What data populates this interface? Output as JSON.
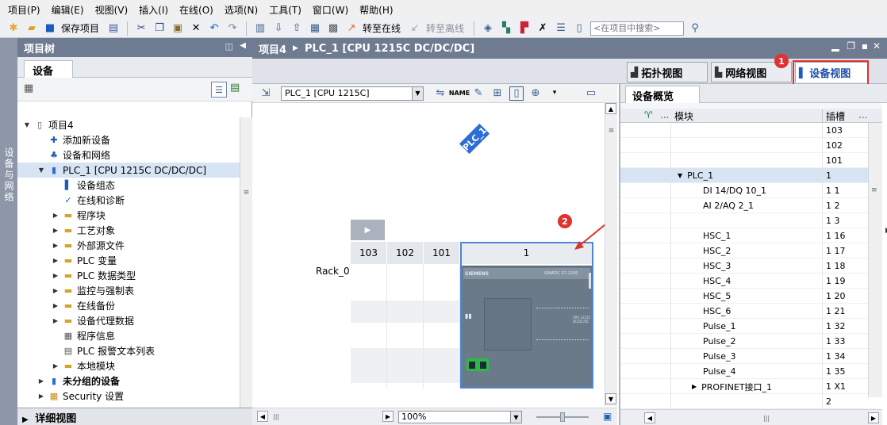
{
  "menu": [
    "项目(P)",
    "编辑(E)",
    "视图(V)",
    "插入(I)",
    "在线(O)",
    "选项(N)",
    "工具(T)",
    "窗口(W)",
    "帮助(H)"
  ],
  "toolbar": {
    "save_project": "保存项目",
    "go_online": "转至在线",
    "go_offline": "转至离线",
    "search_placeholder": "<在项目中搜索>"
  },
  "side_tab": "设备与网络",
  "project_tree": {
    "title": "项目树",
    "tab": "设备",
    "items": [
      {
        "label": "项目4",
        "level": 0,
        "expand": "open",
        "icon": "project-icon"
      },
      {
        "label": "添加新设备",
        "level": 1,
        "expand": "",
        "icon": "add-device-icon"
      },
      {
        "label": "设备和网络",
        "level": 1,
        "expand": "",
        "icon": "network-icon"
      },
      {
        "label": "PLC_1 [CPU 1215C DC/DC/DC]",
        "level": 1,
        "expand": "open",
        "icon": "plc-icon",
        "selected": true
      },
      {
        "label": "设备组态",
        "level": 2,
        "expand": "",
        "icon": "device-config-icon"
      },
      {
        "label": "在线和诊断",
        "level": 2,
        "expand": "",
        "icon": "diagnostics-icon"
      },
      {
        "label": "程序块",
        "level": 2,
        "expand": "closed",
        "icon": "folder-icon"
      },
      {
        "label": "工艺对象",
        "level": 2,
        "expand": "closed",
        "icon": "folder-icon"
      },
      {
        "label": "外部源文件",
        "level": 2,
        "expand": "closed",
        "icon": "folder-icon"
      },
      {
        "label": "PLC 变量",
        "level": 2,
        "expand": "closed",
        "icon": "folder-icon"
      },
      {
        "label": "PLC 数据类型",
        "level": 2,
        "expand": "closed",
        "icon": "folder-icon"
      },
      {
        "label": "监控与强制表",
        "level": 2,
        "expand": "closed",
        "icon": "folder-icon"
      },
      {
        "label": "在线备份",
        "level": 2,
        "expand": "closed",
        "icon": "folder-icon"
      },
      {
        "label": "设备代理数据",
        "level": 2,
        "expand": "closed",
        "icon": "folder-icon"
      },
      {
        "label": "程序信息",
        "level": 2,
        "expand": "",
        "icon": "program-info-icon"
      },
      {
        "label": "PLC 报警文本列表",
        "level": 2,
        "expand": "",
        "icon": "alarm-text-icon"
      },
      {
        "label": "本地模块",
        "level": 2,
        "expand": "closed",
        "icon": "folder-icon"
      },
      {
        "label": "未分组的设备",
        "level": 1,
        "expand": "closed",
        "icon": "ungrouped-icon",
        "bold": true
      },
      {
        "label": "Security 设置",
        "level": 1,
        "expand": "closed",
        "icon": "security-icon"
      }
    ],
    "detail_view": "详细视图"
  },
  "editor": {
    "breadcrumb_project": "项目4",
    "breadcrumb_device": "PLC_1 [CPU 1215C DC/DC/DC]",
    "view_tabs": [
      {
        "label": "拓扑视图",
        "icon": "topology-icon"
      },
      {
        "label": "网络视图",
        "icon": "network-view-icon"
      },
      {
        "label": "设备视图",
        "icon": "device-view-icon",
        "active": true
      }
    ],
    "device_select": "PLC_1 [CPU 1215C]",
    "plc_tag": "PLC_1",
    "rack_label": "Rack_0",
    "slots": [
      "103",
      "102",
      "101",
      "1"
    ],
    "cpu_brand": "SIEMENS",
    "cpu_model": "SIMATIC S7-1200",
    "cpu_type": "CPU 1215C DC/DC/DC",
    "zoom": "100%",
    "badges": [
      "1",
      "2"
    ]
  },
  "overview": {
    "tab": "设备概览",
    "col_module": "模块",
    "col_slot": "插槽",
    "col_more": "...",
    "rows": [
      {
        "module": "",
        "slot": "103",
        "level": 0,
        "expand": ""
      },
      {
        "module": "",
        "slot": "102",
        "level": 0,
        "expand": ""
      },
      {
        "module": "",
        "slot": "101",
        "level": 0,
        "expand": ""
      },
      {
        "module": "PLC_1",
        "slot": "1",
        "level": 1,
        "expand": "open",
        "selected": true
      },
      {
        "module": "DI 14/DQ 10_1",
        "slot": "1 1",
        "level": 2,
        "expand": ""
      },
      {
        "module": "AI 2/AQ 2_1",
        "slot": "1 2",
        "level": 2,
        "expand": ""
      },
      {
        "module": "",
        "slot": "1 3",
        "level": 2,
        "expand": ""
      },
      {
        "module": "HSC_1",
        "slot": "1 16",
        "level": 2,
        "expand": ""
      },
      {
        "module": "HSC_2",
        "slot": "1 17",
        "level": 2,
        "expand": ""
      },
      {
        "module": "HSC_3",
        "slot": "1 18",
        "level": 2,
        "expand": ""
      },
      {
        "module": "HSC_4",
        "slot": "1 19",
        "level": 2,
        "expand": ""
      },
      {
        "module": "HSC_5",
        "slot": "1 20",
        "level": 2,
        "expand": ""
      },
      {
        "module": "HSC_6",
        "slot": "1 21",
        "level": 2,
        "expand": ""
      },
      {
        "module": "Pulse_1",
        "slot": "1 32",
        "level": 2,
        "expand": ""
      },
      {
        "module": "Pulse_2",
        "slot": "1 33",
        "level": 2,
        "expand": ""
      },
      {
        "module": "Pulse_3",
        "slot": "1 34",
        "level": 2,
        "expand": ""
      },
      {
        "module": "Pulse_4",
        "slot": "1 35",
        "level": 2,
        "expand": ""
      },
      {
        "module": "PROFINET接口_1",
        "slot": "1 X1",
        "level": 2,
        "expand": "closed"
      },
      {
        "module": "",
        "slot": "2",
        "level": 0,
        "expand": ""
      }
    ]
  },
  "colors": {
    "title_bar": "#6e7b90",
    "selection": "#d7e4f3",
    "highlight_red": "#e0322e",
    "cpu_blue": "#2b6fd6"
  }
}
